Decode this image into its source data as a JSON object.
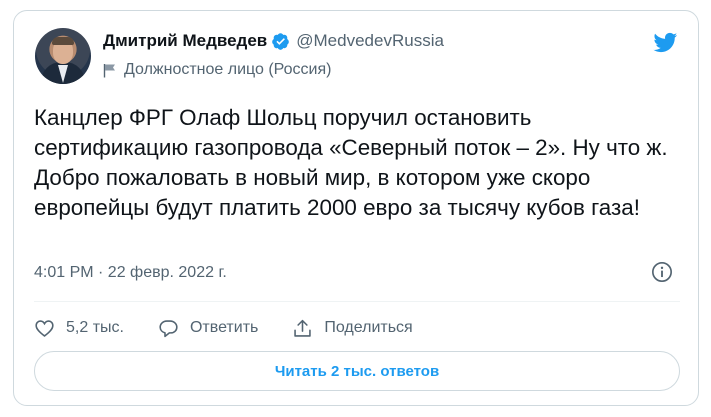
{
  "author": {
    "display_name": "Дмитрий Медведев",
    "handle": "@MedvedevRussia",
    "label": "Должностное лицо (Россия)"
  },
  "tweet": {
    "text": "Канцлер ФРГ Олаф Шольц поручил остановить сертификацию газопровода «Северный поток – 2». Ну что ж. Добро пожаловать в новый мир, в котором уже скоро европейцы будут платить 2000 евро за тысячу кубов газа!",
    "timestamp": "4:01 PM · 22 февр. 2022 г."
  },
  "actions": {
    "like_count": "5,2 тыс.",
    "reply_label": "Ответить",
    "share_label": "Поделиться"
  },
  "read_replies_label": "Читать 2 тыс. ответов",
  "colors": {
    "accent": "#1d9bf0",
    "secondary_text": "#536471",
    "border": "#cfd9de"
  },
  "icons": [
    "verified-badge-icon",
    "flag-icon",
    "twitter-bird-icon",
    "info-icon",
    "heart-icon",
    "reply-icon",
    "share-icon"
  ]
}
